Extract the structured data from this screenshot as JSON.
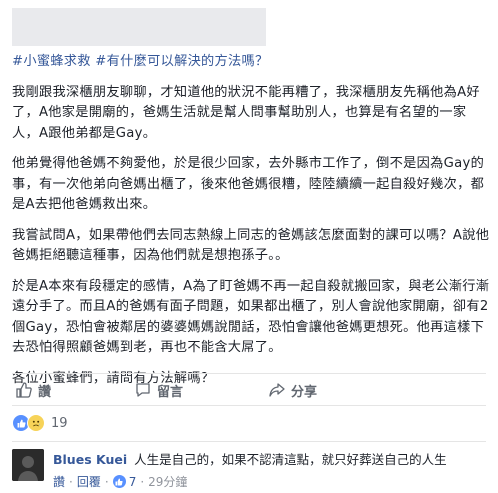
{
  "post": {
    "hashtags": [
      "#小蜜蜂求救",
      "#有什麼可以解決的方法嗎？"
    ],
    "paragraphs": [
      "我剛跟我深櫃朋友聊聊，才知道他的狀況不能再糟了，我深櫃朋友先稱他為A好了，A他家是開廟的，爸媽生活就是幫人問事幫助別人，也算是有名望的一家人，A跟他弟都是Gay。",
      "他弟覺得他爸媽不夠愛他，於是很少回家，去外縣市工作了，倒不是因為Gay的事，有一次他弟向爸媽出櫃了，後來他爸媽很糟，陸陸續續一起自殺好幾次，都是A去把他爸媽救出來。",
      "我嘗試問A，如果帶他們去同志熱線上同志的爸媽該怎麼面對的課可以嗎？A說他爸媽拒絕聽這種事，因為他們就是想抱孫子。。",
      "於是A本來有段穩定的感情，A為了盯爸媽不再一起自殺就搬回家，與老公漸行漸遠分手了。而且A的爸媽有面子問題，如果都出櫃了，別人會說他家開廟，卻有2個Gay，恐怕會被鄰居的婆婆媽媽說閒話，恐怕會讓他爸媽更想死。他再這樣下去恐怕得照顧爸媽到老，再也不能含大屌了。",
      "各位小蜜蜂們，請問有方法解嗎？"
    ]
  },
  "actions": {
    "like_label": "讚",
    "comment_label": "留言",
    "share_label": "分享",
    "like_icon": "thumbs-up-icon",
    "comment_icon": "speech-bubble-icon",
    "share_icon": "share-arrow-icon"
  },
  "reactions": {
    "count": "19",
    "types": [
      "like",
      "sad"
    ]
  },
  "comment": {
    "author": "Blues Kuei",
    "text": "人生是自己的，如果不認清這點，就只好葬送自己的人生",
    "like_label": "讚",
    "reply_label": "回覆",
    "like_count": "7",
    "time": "29分鐘"
  },
  "colors": {
    "link": "#365899",
    "text": "#1d2129",
    "muted": "#616770",
    "like_blue": "#5890ff",
    "sad_yellow": "#f7d358"
  }
}
